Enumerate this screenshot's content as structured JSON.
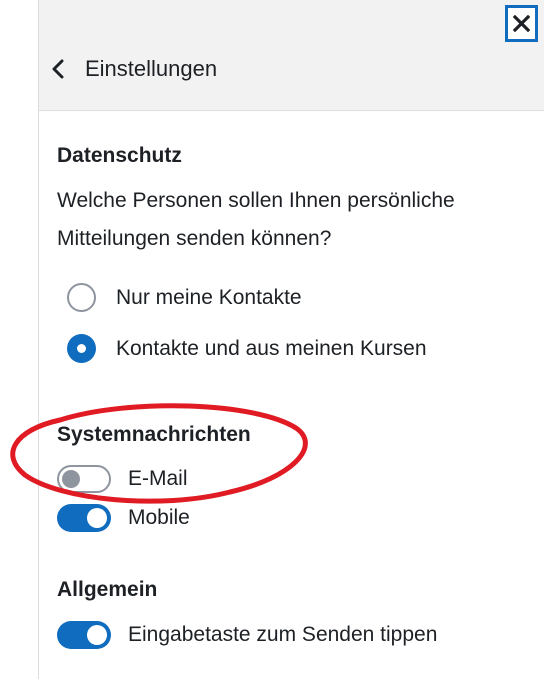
{
  "header": {
    "back_label": "Einstellungen",
    "close_symbol": "×"
  },
  "privacy": {
    "title": "Datenschutz",
    "question": "Welche Personen sollen Ihnen persönliche Mitteilungen senden können?",
    "options": [
      {
        "label": "Nur meine Kontakte",
        "checked": false
      },
      {
        "label": "Kontakte und aus meinen Kursen",
        "checked": true
      }
    ]
  },
  "system_notifications": {
    "title": "Systemnachrichten",
    "items": [
      {
        "label": "E-Mail",
        "enabled": false
      },
      {
        "label": "Mobile",
        "enabled": true
      }
    ]
  },
  "general": {
    "title": "Allgemein",
    "items": [
      {
        "label": "Eingabetaste zum Senden tippen",
        "enabled": true
      }
    ]
  },
  "colors": {
    "accent": "#0f6cbf",
    "annotation": "#e01b24",
    "header_bg": "#f2f2f2"
  },
  "icons": {
    "back": "chevron-left-icon",
    "close": "close-icon"
  }
}
